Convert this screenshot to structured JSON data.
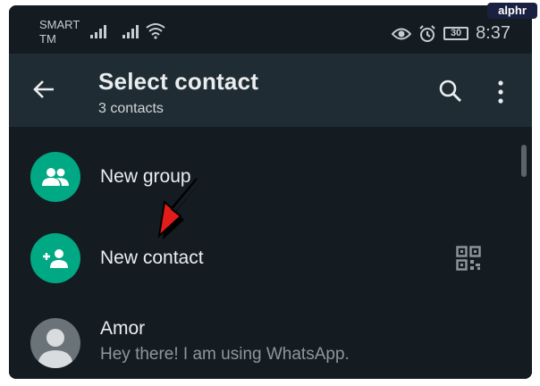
{
  "watermark": {
    "text": "alphr"
  },
  "status_bar": {
    "carrier_line1": "SMART",
    "carrier_line2": "TM",
    "battery": "30",
    "time": "8:37",
    "icons": [
      "signal-icon",
      "signal-icon",
      "wifi-icon",
      "eye-icon",
      "alarm-icon",
      "battery-icon"
    ]
  },
  "header": {
    "title": "Select contact",
    "subtitle": "3 contacts",
    "icons": [
      "back-arrow-icon",
      "search-icon",
      "more-vert-icon"
    ]
  },
  "list": {
    "items": [
      {
        "label": "New group",
        "icon": "group-icon"
      },
      {
        "label": "New contact",
        "icon": "add-person-icon",
        "trailing_icon": "qr-code-icon"
      },
      {
        "label": "Amor",
        "status": "Hey there! I am using WhatsApp.",
        "icon": "default-avatar-icon"
      }
    ]
  },
  "colors": {
    "accent": "#00a884",
    "background": "#141c21",
    "header": "#1f2c33",
    "annotation": "#e21b1b"
  },
  "annotation": {
    "icon": "red-arrow-icon"
  }
}
